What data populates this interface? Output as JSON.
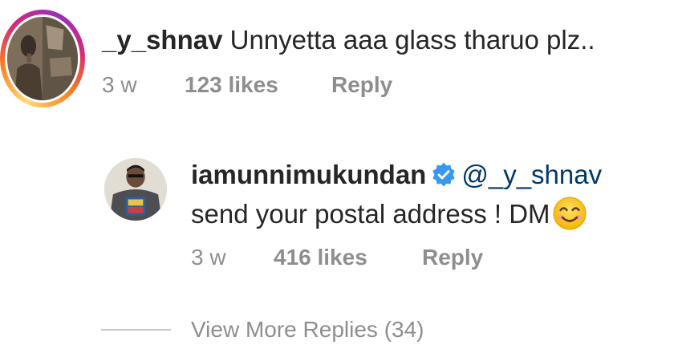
{
  "comments": [
    {
      "username": "_y_shnav",
      "text": "Unnyetta aaa glass tharuo plz..",
      "time": "3 w",
      "likes": "123 likes",
      "reply_label": "Reply",
      "has_story_ring": true
    }
  ],
  "reply": {
    "username": "iamunnimukundan",
    "verified": true,
    "mention": "@_y_shnav",
    "text": "send your postal address ! DM",
    "emoji": "smiling-face-emoji",
    "time": "3 w",
    "likes": "416 likes",
    "reply_label": "Reply"
  },
  "view_more": {
    "label": "View More Replies (34)"
  },
  "colors": {
    "text_primary": "#262626",
    "text_secondary": "#8e8e8e",
    "mention": "#00376b",
    "verified_badge": "#3897f0",
    "divider": "#c7c7c7"
  }
}
